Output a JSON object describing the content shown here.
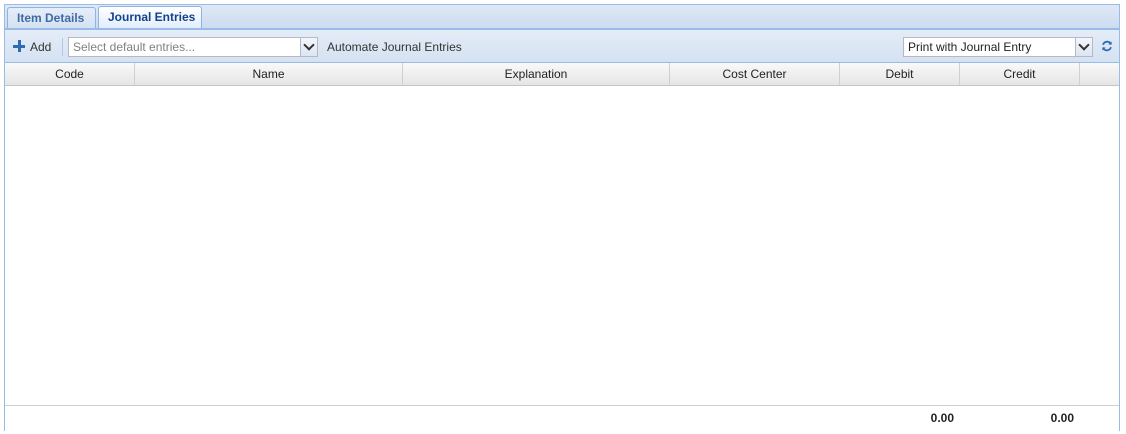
{
  "tabs": [
    {
      "label": "Item Details",
      "active": false
    },
    {
      "label": "Journal Entries",
      "active": true
    }
  ],
  "toolbar": {
    "add_label": "Add",
    "entries_placeholder": "Select default entries...",
    "automate_label": "Automate Journal Entries",
    "print_value": "Print with Journal Entry"
  },
  "grid": {
    "columns": [
      "Code",
      "Name",
      "Explanation",
      "Cost Center",
      "Debit",
      "Credit"
    ],
    "rows": [],
    "totals": {
      "debit": "0.00",
      "credit": "0.00"
    }
  },
  "colors": {
    "accent": "#15428b",
    "border": "#99bbe8",
    "icon": "#2e6bb7"
  },
  "icons": {
    "add": "plus-icon",
    "refresh": "refresh-icon",
    "dropdown": "chevron-down-icon"
  }
}
